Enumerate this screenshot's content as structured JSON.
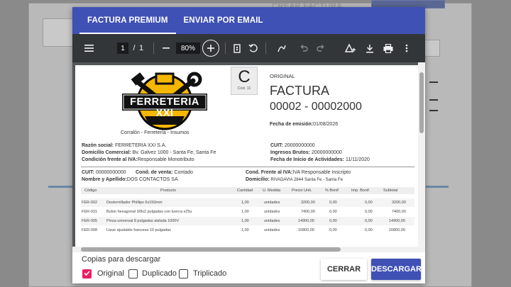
{
  "background": {
    "title": "CREAR FACTURA"
  },
  "tabs": [
    {
      "label": "FACTURA PREMIUM"
    },
    {
      "label": "ENVIAR POR EMAIL"
    }
  ],
  "toolbar": {
    "page_current": "1",
    "page_sep": "/",
    "page_total": "1",
    "zoom": "80%"
  },
  "invoice": {
    "logo_text": "FERRETERIA XXI",
    "slogan": "Corralón - Ferretería - Insumos",
    "letter": "C",
    "cod": "Cod. 11",
    "copy_label": "ORIGINAL",
    "doc_type": "FACTURA",
    "number": "00002 - 00002000",
    "fecha_label": "Fecha de emisión:",
    "fecha_value": "01/08/2026",
    "issuer": {
      "razon_label": "Razón social:",
      "razon_value": "FERRETERIA XXI S.A.",
      "domicilio_label": "Domicilio Comercial:",
      "domicilio_value": "Bv. Galvez 1000 - Santa Fe, Santa Fe",
      "iva_label": "Condición frente al IVA:",
      "iva_value": "Responsable Monotributo",
      "cuit_label": "CUIT:",
      "cuit_value": "20000000000",
      "ib_label": "Ingresos Brutos:",
      "ib_value": "20000000000",
      "inicio_label": "Fecha de Inicio de Actividades:",
      "inicio_value": "11/11/2020"
    },
    "client": {
      "cuit_label": "CUIT:",
      "cuit_value": "00000000000",
      "venta_label": "Cond. de venta:",
      "venta_value": "Contado",
      "nombre_label": "Nombre y Apellido:",
      "nombre_value": "DOS CONTACTOS SA",
      "iva_label": "Cond. Frente al IVA:",
      "iva_value": "IVA Responsable Inscripto",
      "domicilio_label": "Domicilio:",
      "domicilio_value": "RIVADAVIA 2844 Santa Fe - Santa Fe"
    },
    "columns": [
      "Código",
      "Producto",
      "Cantidad",
      "U. Medida",
      "Precio Unit.",
      "% Bonif",
      "Imp. Bonif.",
      "Subtotal"
    ],
    "rows": [
      [
        "FER-002",
        "Destornillador Phillips 6x150mm",
        "1,00",
        "unidades",
        "3200,00",
        "0,00",
        "0,00",
        "3200,00"
      ],
      [
        "FER-031",
        "Bulon hexagonal 3/8x2 pulgadas con tuerca x25u",
        "1,00",
        "unidades",
        "7400,00",
        "0,00",
        "0,00",
        "7400,00"
      ],
      [
        "FER-005",
        "Pinza universal 8 pulgadas aislada 1000V",
        "1,00",
        "unidades",
        "14900,00",
        "0,00",
        "0,00",
        "14900,00"
      ],
      [
        "FER-008",
        "Llave ajustable francesa 10 pulgadas",
        "1,00",
        "unidades",
        "16800,00",
        "0,00",
        "0,00",
        "16800,00"
      ]
    ]
  },
  "footer": {
    "copias_label": "Copias para descargar",
    "options": [
      {
        "label": "Original",
        "checked": true
      },
      {
        "label": "Duplicado",
        "checked": false
      },
      {
        "label": "Triplicado",
        "checked": false
      }
    ],
    "close_label": "CERRAR",
    "download_label": "DESCARGAR"
  },
  "colors": {
    "primary": "#3f51b5",
    "checkbox": "#e91e63",
    "toolbar": "#323639"
  }
}
